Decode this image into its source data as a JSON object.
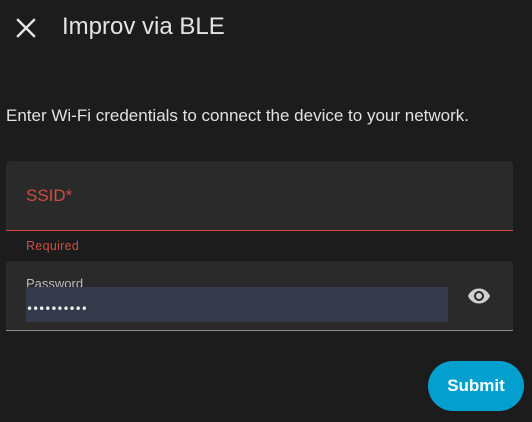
{
  "dialog": {
    "title": "Improv via BLE",
    "close_icon": "close-icon",
    "description": "Enter Wi-Fi credentials to connect the device to your network."
  },
  "form": {
    "ssid": {
      "label": "SSID*",
      "value": "",
      "helper_text": "Required",
      "state": "error"
    },
    "password": {
      "label": "Password",
      "value": "••••••••••",
      "visibility_icon": "eye-icon"
    },
    "submit_label": "Submit"
  },
  "colors": {
    "background": "#1c1c1c",
    "field_background": "#2a2a2a",
    "error": "#d24a42",
    "accent": "#039fcf",
    "autofill_highlight": "#343a49"
  }
}
